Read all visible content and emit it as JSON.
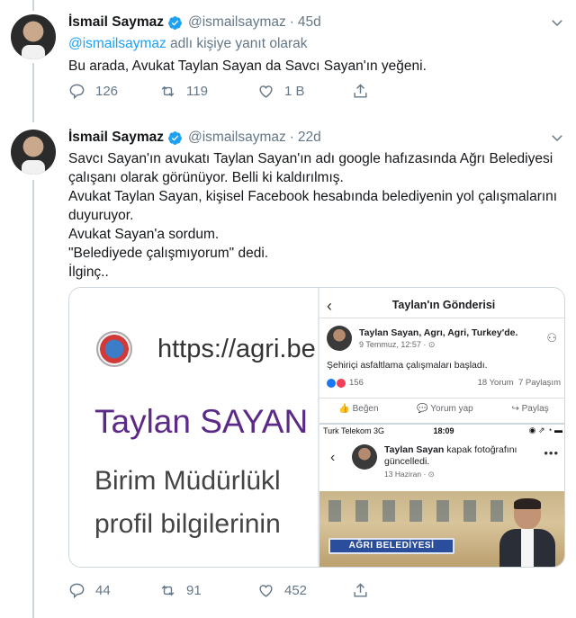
{
  "colors": {
    "link": "#1da1f2",
    "muted": "#657786",
    "verified": "#1da1f2",
    "text": "#14171a"
  },
  "tweet1": {
    "name": "İsmail Saymaz",
    "handle": "@ismailsaymaz",
    "dot": "·",
    "time": "45d",
    "reply_handle": "@ismailsaymaz",
    "reply_suffix": " adlı kişiye yanıt olarak",
    "text": "Bu arada, Avukat Taylan Sayan da Savcı Sayan'ın yeğeni.",
    "replies": "126",
    "retweets": "119",
    "likes": "1 B"
  },
  "tweet2": {
    "name": "İsmail Saymaz",
    "handle": "@ismailsaymaz",
    "dot": "·",
    "time": "22d",
    "lines": [
      "Savcı Sayan'ın avukatı Taylan Sayan'ın adı google hafızasında Ağrı Belediyesi",
      "çalışanı olarak görünüyor. Belli ki kaldırılmış.",
      "Avukat Taylan Sayan, kişisel Facebook hesabında belediyenin yol çalışmalarını",
      "duyuruyor.",
      "Avukat Sayan'a sordum.",
      "\"Belediyede çalışmıyorum\" dedi.",
      "İlginç.."
    ],
    "replies": "44",
    "retweets": "91",
    "likes": "452"
  },
  "media": {
    "left": {
      "url": "https://agri.be",
      "name": "Taylan SAYAN",
      "line1": "Birim Müdürlükl",
      "line2": "profil bilgilerinin"
    },
    "fb_post": {
      "back": "‹",
      "title": "Taylan'ın Gönderisi",
      "author": "Taylan Sayan, Agrı, Agri, Turkey'de.",
      "date": "9 Temmuz, 12:57 · ⊙",
      "person_icon": "⚇",
      "text": "Şehiriçi asfaltlama çalışmaları başladı.",
      "reactions": "156",
      "comments": "18 Yorum",
      "shares": "7 Paylaşım",
      "like": "Beğen",
      "comment": "Yorum yap",
      "share": "Paylaş"
    },
    "fb_cover": {
      "carrier": "Turk Telekom  3G",
      "clock": "18:09",
      "status_right": "◉ ⇗ ◔ ▬",
      "back": "‹",
      "author": "Taylan Sayan",
      "action": " kapak fotoğrafını güncelledi.",
      "date": "13 Haziran · ⊙",
      "more": "•••",
      "sign": "AĞRI BELEDİYESİ"
    }
  }
}
